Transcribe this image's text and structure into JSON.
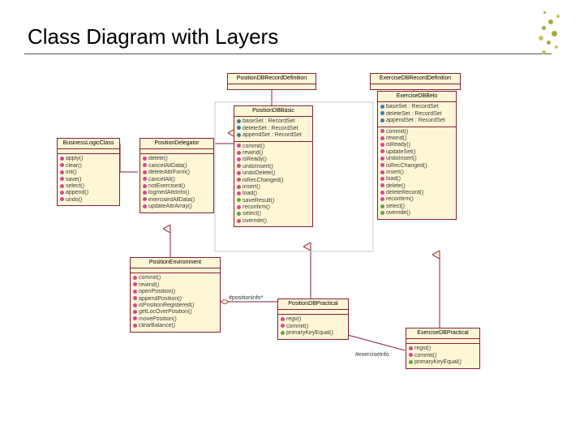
{
  "title": "Class Diagram with Layers",
  "labels": {
    "positionInfo": "#positionInfo*",
    "exerciseInfo": "#exerciseInfo"
  },
  "classes": {
    "positionDBRecordDefn": {
      "name": "PositionDBRecordDefinition",
      "attrs": [],
      "ops": []
    },
    "exerciseDBRecordDefn": {
      "name": "ExerciseDBRecordDefinition",
      "attrs": [],
      "ops": []
    },
    "positionDBBasic": {
      "name": "PositionDBBasic",
      "attrs": [
        "baseSet : RecordSet",
        "deleteSet : RecordSet",
        "appendSet : RecordSet"
      ],
      "ops": [
        "commit()",
        "rewind()",
        "isReady()",
        "undoInsert()",
        "undoDelete()",
        "isRecChanged()",
        "insert()",
        "load()",
        "saveResult()",
        "reconfirm()",
        "select()",
        "override()"
      ]
    },
    "exerciseDBBelo": {
      "name": "ExerciseDBBelo",
      "attrs": [
        "baseSet : RecordSet",
        "deleteSet : RecordSet",
        "appendSet : RecordSet"
      ],
      "ops": [
        "commit()",
        "rewind()",
        "isReady()",
        "updateSet()",
        "undoInsert()",
        "isRecChanged()",
        "insert()",
        "load()",
        "delete()",
        "deleteRecord()",
        "reconfirm()",
        "select()",
        "override()"
      ]
    },
    "businessLogicClass": {
      "name": "BusinessLogicClass",
      "attrs": [],
      "ops": [
        "apply()",
        "clear()",
        "init()",
        "save()",
        "select()",
        "append()",
        "undo()"
      ]
    },
    "positionDelegator": {
      "name": "PositionDelegator",
      "attrs": [],
      "ops": [
        "delete()",
        "cancelAllData()",
        "deleteAttrForm()",
        "cancelAll()",
        "notExercised()",
        "logmedAttrInfo()",
        "exercisedAllData()",
        "updateAttrArray()"
      ]
    },
    "positionEnvironment": {
      "name": "PositionEnvironment",
      "attrs": [],
      "ops": [
        "commit()",
        "rewind()",
        "openPosition()",
        "appendPosition()",
        "isPositionRegistered()",
        "getLocOverPosition()",
        "movePosition()",
        "clearBalance()"
      ]
    },
    "positionDBPractical": {
      "name": "PositionDBPractical",
      "attrs": [],
      "ops": [
        "regv()",
        "commit()",
        "primaryKeyEqual()"
      ]
    },
    "exerciseDBPractical": {
      "name": "ExerciseDBPractical",
      "attrs": [],
      "ops": [
        "regst()",
        "commit()",
        "primaryKeyEqual()"
      ]
    }
  }
}
